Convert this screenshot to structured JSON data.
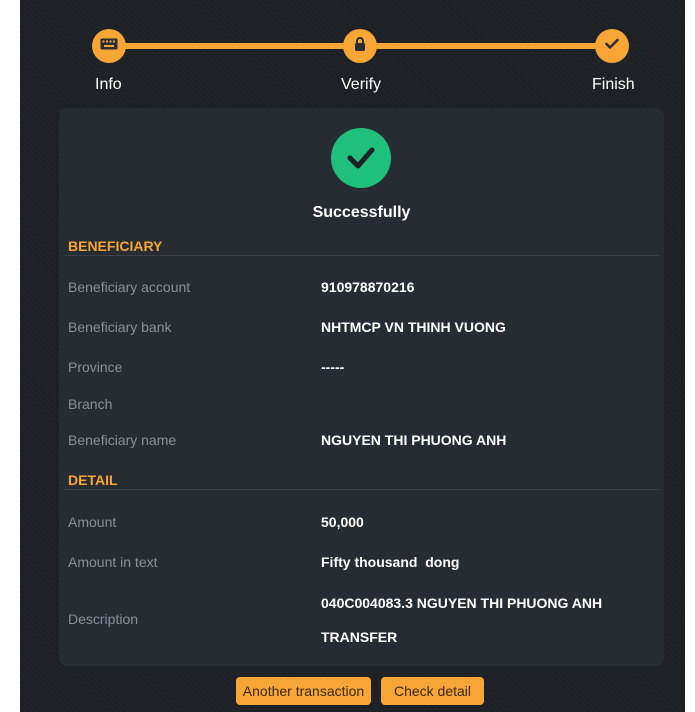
{
  "stepper": {
    "steps": [
      {
        "label": "Info",
        "icon": "keyboard-icon"
      },
      {
        "label": "Verify",
        "icon": "lock-icon"
      },
      {
        "label": "Finish",
        "icon": "check-icon"
      }
    ]
  },
  "result": {
    "status_text": "Successfully",
    "icon": "check-circle-icon"
  },
  "beneficiary": {
    "section_title": "BENEFICIARY",
    "rows": [
      {
        "label": "Beneficiary account",
        "value": "910978870216"
      },
      {
        "label": "Beneficiary bank",
        "value": "NHTMCP VN THINH VUONG"
      },
      {
        "label": "Province",
        "value": "-----"
      },
      {
        "label": "Branch",
        "value": ""
      },
      {
        "label": "Beneficiary name",
        "value": "NGUYEN THI PHUONG ANH"
      }
    ]
  },
  "detail": {
    "section_title": "DETAIL",
    "rows": [
      {
        "label": "Amount",
        "value": "50,000"
      },
      {
        "label": "Amount in text",
        "value": "Fifty thousand  dong"
      },
      {
        "label": "Description",
        "value_line1": "040C004083.3 NGUYEN THI PHUONG ANH",
        "value_line2": "TRANSFER"
      }
    ]
  },
  "actions": {
    "another_label": "Another transaction",
    "check_label": "Check detail"
  },
  "colors": {
    "accent": "#f7a534",
    "success": "#1fbf7c",
    "background": "#1d2025",
    "card": "#272c33"
  }
}
